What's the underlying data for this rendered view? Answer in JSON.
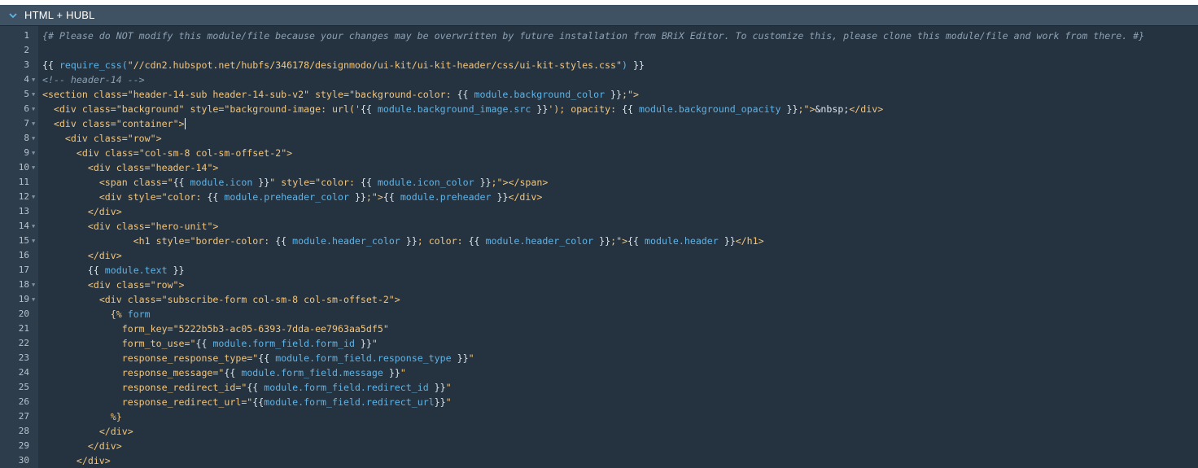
{
  "panel": {
    "title": "HTML + HUBL"
  },
  "lines": [
    {
      "n": "1",
      "fold": false,
      "segs": [
        [
          "cm",
          "{# Please do NOT modify this module/file because your changes may be overwritten by future installation from BRiX Editor. To customize this, please clone this module/file and work from there. #}"
        ]
      ]
    },
    {
      "n": "2",
      "fold": false,
      "segs": []
    },
    {
      "n": "3",
      "fold": false,
      "segs": [
        [
          "pl",
          "{{ "
        ],
        [
          "hl",
          "require_css("
        ],
        [
          "st",
          "\"//cdn2.hubspot.net/hubfs/346178/designmodo/ui-kit/ui-kit-header/css/ui-kit-styles.css\""
        ],
        [
          "hl",
          ")"
        ],
        [
          "pl",
          " }}"
        ]
      ]
    },
    {
      "n": "4",
      "fold": true,
      "segs": [
        [
          "cm",
          "<!-- header-14 -->"
        ]
      ]
    },
    {
      "n": "5",
      "fold": true,
      "segs": [
        [
          "tg",
          "<section "
        ],
        [
          "at",
          "class="
        ],
        [
          "st",
          "\"header-14-sub header-14-sub-v2\" "
        ],
        [
          "at",
          "style="
        ],
        [
          "st",
          "\"background-color: "
        ],
        [
          "pl",
          "{{ "
        ],
        [
          "hl",
          "module.background_color"
        ],
        [
          "pl",
          " }}"
        ],
        [
          "st",
          ";\""
        ],
        [
          "tg",
          ">"
        ]
      ]
    },
    {
      "n": "6",
      "fold": true,
      "segs": [
        [
          "pl",
          "  "
        ],
        [
          "tg",
          "<div "
        ],
        [
          "at",
          "class="
        ],
        [
          "st",
          "\"background\" "
        ],
        [
          "at",
          "style="
        ],
        [
          "st",
          "\"background-image: url('"
        ],
        [
          "pl",
          "{{ "
        ],
        [
          "hl",
          "module.background_image.src"
        ],
        [
          "pl",
          " }}"
        ],
        [
          "st",
          "'); opacity: "
        ],
        [
          "pl",
          "{{ "
        ],
        [
          "hl",
          "module.background_opacity"
        ],
        [
          "pl",
          " }}"
        ],
        [
          "st",
          ";\""
        ],
        [
          "tg",
          ">"
        ],
        [
          "pl",
          "&nbsp;"
        ],
        [
          "tg",
          "</div>"
        ]
      ]
    },
    {
      "n": "7",
      "fold": true,
      "cursor": true,
      "segs": [
        [
          "pl",
          "  "
        ],
        [
          "tg",
          "<div "
        ],
        [
          "at",
          "class="
        ],
        [
          "st",
          "\"container\""
        ],
        [
          "tg",
          ">"
        ]
      ]
    },
    {
      "n": "8",
      "fold": true,
      "segs": [
        [
          "pl",
          "    "
        ],
        [
          "tg",
          "<div "
        ],
        [
          "at",
          "class="
        ],
        [
          "st",
          "\"row\""
        ],
        [
          "tg",
          ">"
        ]
      ]
    },
    {
      "n": "9",
      "fold": true,
      "segs": [
        [
          "pl",
          "      "
        ],
        [
          "tg",
          "<div "
        ],
        [
          "at",
          "class="
        ],
        [
          "st",
          "\"col-sm-8 col-sm-offset-2\""
        ],
        [
          "tg",
          ">"
        ]
      ]
    },
    {
      "n": "10",
      "fold": true,
      "segs": [
        [
          "pl",
          "        "
        ],
        [
          "tg",
          "<div "
        ],
        [
          "at",
          "class="
        ],
        [
          "st",
          "\"header-14\""
        ],
        [
          "tg",
          ">"
        ]
      ]
    },
    {
      "n": "11",
      "fold": false,
      "segs": [
        [
          "pl",
          "          "
        ],
        [
          "tg",
          "<span "
        ],
        [
          "at",
          "class="
        ],
        [
          "st",
          "\""
        ],
        [
          "pl",
          "{{ "
        ],
        [
          "hl",
          "module.icon"
        ],
        [
          "pl",
          " }}"
        ],
        [
          "st",
          "\" "
        ],
        [
          "at",
          "style="
        ],
        [
          "st",
          "\"color: "
        ],
        [
          "pl",
          "{{ "
        ],
        [
          "hl",
          "module.icon_color"
        ],
        [
          "pl",
          " }}"
        ],
        [
          "st",
          ";\""
        ],
        [
          "tg",
          "></span>"
        ]
      ]
    },
    {
      "n": "12",
      "fold": true,
      "segs": [
        [
          "pl",
          "          "
        ],
        [
          "tg",
          "<div "
        ],
        [
          "at",
          "style="
        ],
        [
          "st",
          "\"color: "
        ],
        [
          "pl",
          "{{ "
        ],
        [
          "hl",
          "module.preheader_color"
        ],
        [
          "pl",
          " }}"
        ],
        [
          "st",
          ";\""
        ],
        [
          "tg",
          ">"
        ],
        [
          "pl",
          "{{ "
        ],
        [
          "hl",
          "module.preheader"
        ],
        [
          "pl",
          " }}"
        ],
        [
          "tg",
          "</div>"
        ]
      ]
    },
    {
      "n": "13",
      "fold": false,
      "segs": [
        [
          "pl",
          "        "
        ],
        [
          "tg",
          "</div>"
        ]
      ]
    },
    {
      "n": "14",
      "fold": true,
      "segs": [
        [
          "pl",
          "        "
        ],
        [
          "tg",
          "<div "
        ],
        [
          "at",
          "class="
        ],
        [
          "st",
          "\"hero-unit\""
        ],
        [
          "tg",
          ">"
        ]
      ]
    },
    {
      "n": "15",
      "fold": true,
      "segs": [
        [
          "pl",
          "                "
        ],
        [
          "tg",
          "<h1 "
        ],
        [
          "at",
          "style="
        ],
        [
          "st",
          "\"border-color: "
        ],
        [
          "pl",
          "{{ "
        ],
        [
          "hl",
          "module.header_color"
        ],
        [
          "pl",
          " }}"
        ],
        [
          "st",
          "; color: "
        ],
        [
          "pl",
          "{{ "
        ],
        [
          "hl",
          "module.header_color"
        ],
        [
          "pl",
          " }}"
        ],
        [
          "st",
          ";\""
        ],
        [
          "tg",
          ">"
        ],
        [
          "pl",
          "{{ "
        ],
        [
          "hl",
          "module.header"
        ],
        [
          "pl",
          " }}"
        ],
        [
          "tg",
          "</h1>"
        ]
      ]
    },
    {
      "n": "16",
      "fold": false,
      "segs": [
        [
          "pl",
          "        "
        ],
        [
          "tg",
          "</div>"
        ]
      ]
    },
    {
      "n": "17",
      "fold": false,
      "segs": [
        [
          "pl",
          "        "
        ],
        [
          "pl",
          "{{ "
        ],
        [
          "hl",
          "module.text"
        ],
        [
          "pl",
          " }}"
        ]
      ]
    },
    {
      "n": "18",
      "fold": true,
      "segs": [
        [
          "pl",
          "        "
        ],
        [
          "tg",
          "<div "
        ],
        [
          "at",
          "class="
        ],
        [
          "st",
          "\"row\""
        ],
        [
          "tg",
          ">"
        ]
      ]
    },
    {
      "n": "19",
      "fold": true,
      "segs": [
        [
          "pl",
          "          "
        ],
        [
          "tg",
          "<div "
        ],
        [
          "at",
          "class="
        ],
        [
          "st",
          "\"subscribe-form col-sm-8 col-sm-offset-2\""
        ],
        [
          "tg",
          ">"
        ]
      ]
    },
    {
      "n": "20",
      "fold": false,
      "segs": [
        [
          "pl",
          "            "
        ],
        [
          "tg",
          "{% "
        ],
        [
          "hl",
          "form"
        ]
      ]
    },
    {
      "n": "21",
      "fold": false,
      "segs": [
        [
          "pl",
          "              "
        ],
        [
          "at",
          "form_key="
        ],
        [
          "st",
          "\"5222b5b3-ac05-6393-7dda-ee7963aa5df5\""
        ]
      ]
    },
    {
      "n": "22",
      "fold": false,
      "segs": [
        [
          "pl",
          "              "
        ],
        [
          "at",
          "form_to_use="
        ],
        [
          "st",
          "\""
        ],
        [
          "pl",
          "{{ "
        ],
        [
          "hl",
          "module.form_field.form_id"
        ],
        [
          "pl",
          " }}"
        ],
        [
          "st",
          "\""
        ]
      ]
    },
    {
      "n": "23",
      "fold": false,
      "segs": [
        [
          "pl",
          "              "
        ],
        [
          "at",
          "response_response_type="
        ],
        [
          "st",
          "\""
        ],
        [
          "pl",
          "{{ "
        ],
        [
          "hl",
          "module.form_field.response_type"
        ],
        [
          "pl",
          " }}"
        ],
        [
          "st",
          "\""
        ]
      ]
    },
    {
      "n": "24",
      "fold": false,
      "segs": [
        [
          "pl",
          "              "
        ],
        [
          "at",
          "response_message="
        ],
        [
          "st",
          "\""
        ],
        [
          "pl",
          "{{ "
        ],
        [
          "hl",
          "module.form_field.message"
        ],
        [
          "pl",
          " }}"
        ],
        [
          "st",
          "\""
        ]
      ]
    },
    {
      "n": "25",
      "fold": false,
      "segs": [
        [
          "pl",
          "              "
        ],
        [
          "at",
          "response_redirect_id="
        ],
        [
          "st",
          "\""
        ],
        [
          "pl",
          "{{ "
        ],
        [
          "hl",
          "module.form_field.redirect_id"
        ],
        [
          "pl",
          " }}"
        ],
        [
          "st",
          "\""
        ]
      ]
    },
    {
      "n": "26",
      "fold": false,
      "segs": [
        [
          "pl",
          "              "
        ],
        [
          "at",
          "response_redirect_url="
        ],
        [
          "st",
          "\""
        ],
        [
          "pl",
          "{{"
        ],
        [
          "hl",
          "module.form_field.redirect_url"
        ],
        [
          "pl",
          "}}"
        ],
        [
          "st",
          "\""
        ]
      ]
    },
    {
      "n": "27",
      "fold": false,
      "segs": [
        [
          "pl",
          "            "
        ],
        [
          "tg",
          "%}"
        ]
      ]
    },
    {
      "n": "28",
      "fold": false,
      "segs": [
        [
          "pl",
          "          "
        ],
        [
          "tg",
          "</div>"
        ]
      ]
    },
    {
      "n": "29",
      "fold": false,
      "segs": [
        [
          "pl",
          "        "
        ],
        [
          "tg",
          "</div>"
        ]
      ]
    },
    {
      "n": "30",
      "fold": false,
      "segs": [
        [
          "pl",
          "      "
        ],
        [
          "tg",
          "</div>"
        ]
      ]
    }
  ]
}
